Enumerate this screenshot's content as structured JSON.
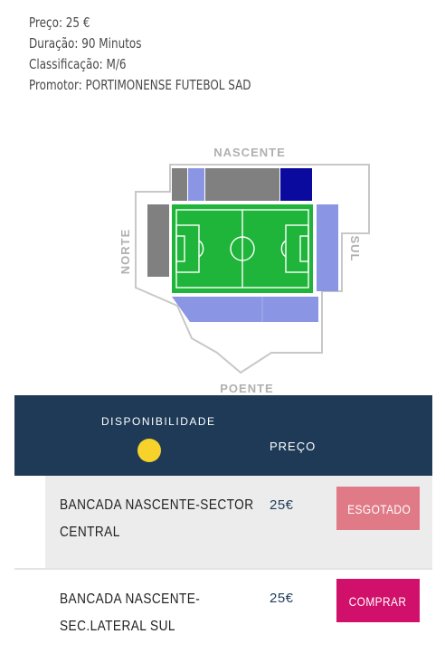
{
  "event_info": {
    "price": "Preço: 25 €",
    "duration": "Duração: 90 Minutos",
    "classification": "Classificação: M/6",
    "promoter": "Promotor: PORTIMONENSE FUTEBOL SAD"
  },
  "stadium_map": {
    "north_label": "NORTE",
    "east_label": "NASCENTE",
    "south_label": "SUL",
    "west_label": "POENTE",
    "colors": {
      "pitch": "#1fb53a",
      "sold_out": "#808080",
      "available": "#8a96e4",
      "selected": "#0a0a9e",
      "outline": "#c8c8c8"
    }
  },
  "availability_table": {
    "availability_header": "DISPONIBILIDADE",
    "price_header": "PREÇO",
    "status_color": "#f6d22a",
    "rows": [
      {
        "label_line1": "BANCADA NASCENTE-SECTOR",
        "label_line2": "CENTRAL",
        "price": "25€",
        "button": "ESGOTADO",
        "button_color": "#e07a86"
      },
      {
        "label_line1": "BANCADA NASCENTE-",
        "label_line2": "SEC.LATERAL SUL",
        "price": "25€",
        "button": "COMPRAR",
        "button_color": "#d0106a"
      }
    ]
  }
}
